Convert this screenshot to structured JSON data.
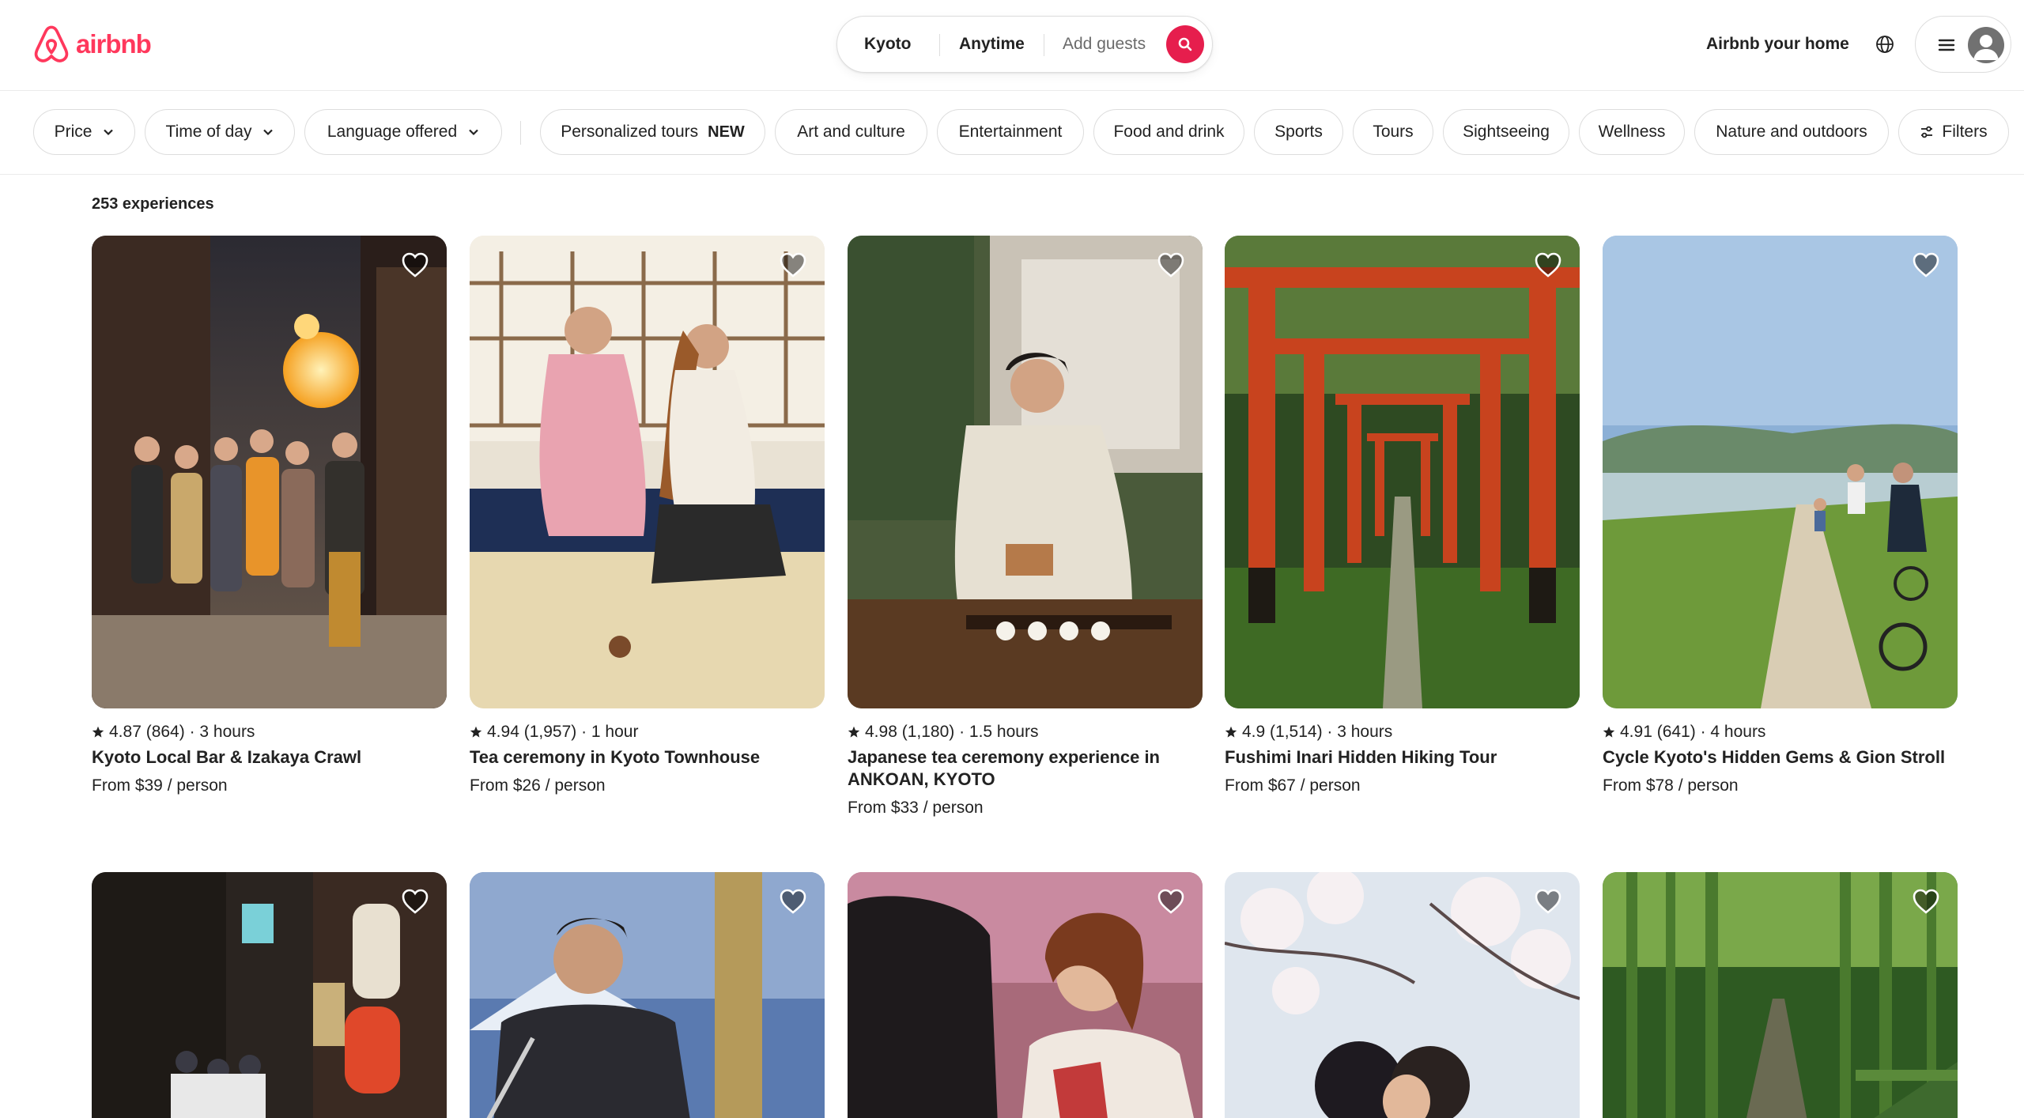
{
  "brand": {
    "name": "airbnb",
    "color": "#ff385c"
  },
  "search": {
    "where": "Kyoto",
    "when": "Anytime",
    "who": "Add guests",
    "button_color": "#e61e4d"
  },
  "header": {
    "host_link": "Airbnb your home"
  },
  "filters": {
    "price": "Price",
    "time_of_day": "Time of day",
    "language": "Language offered",
    "categories": [
      {
        "label": "Personalized tours",
        "badge": "NEW"
      },
      {
        "label": "Art and culture"
      },
      {
        "label": "Entertainment"
      },
      {
        "label": "Food and drink"
      },
      {
        "label": "Sports"
      },
      {
        "label": "Tours"
      },
      {
        "label": "Sightseeing"
      },
      {
        "label": "Wellness"
      },
      {
        "label": "Nature and outdoors"
      }
    ],
    "filters_button": "Filters"
  },
  "results": {
    "count": "253 experiences",
    "cards": [
      {
        "rating": "4.87 (864) · 3 hours",
        "title": "Kyoto Local Bar & Izakaya Crawl",
        "price": "From $39 / person"
      },
      {
        "rating": "4.94 (1,957) · 1 hour",
        "title": "Tea ceremony in Kyoto Townhouse",
        "price": "From $26 / person"
      },
      {
        "rating": "4.98 (1,180) · 1.5 hours",
        "title": "Japanese tea ceremony experience in ANKOAN, KYOTO",
        "price": "From $33 / person"
      },
      {
        "rating": "4.9 (1,514) · 3 hours",
        "title": "Fushimi Inari Hidden Hiking Tour",
        "price": "From $67 / person"
      },
      {
        "rating": "4.91 (641) · 4 hours",
        "title": "Cycle Kyoto's Hidden Gems & Gion Stroll",
        "price": "From $78 / person"
      }
    ]
  }
}
